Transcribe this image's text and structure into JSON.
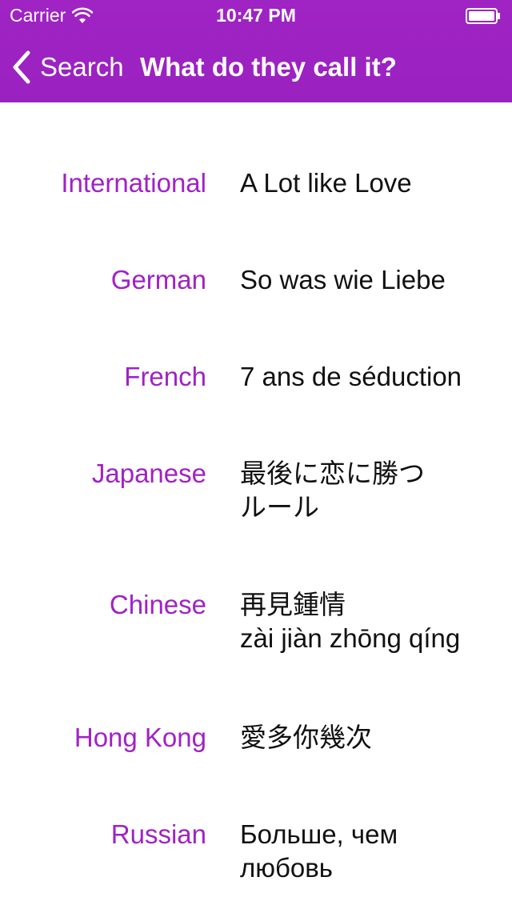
{
  "status_bar": {
    "carrier": "Carrier",
    "time": "10:47 PM"
  },
  "nav": {
    "back_label": "Search",
    "title": "What do they call it?"
  },
  "colors": {
    "header_bg": "#9e22c2",
    "label_color": "#a022c6",
    "value_color": "#111111"
  },
  "titles": [
    {
      "language": "International",
      "lines": [
        "A Lot like Love"
      ]
    },
    {
      "language": "German",
      "lines": [
        "So was wie Liebe"
      ]
    },
    {
      "language": "French",
      "lines": [
        "7 ans de séduction"
      ]
    },
    {
      "language": "Japanese",
      "lines": [
        "最後に恋に勝つ",
        "ルール"
      ]
    },
    {
      "language": "Chinese",
      "lines": [
        "再見鍾情",
        "zài jiàn zhōng qíng"
      ]
    },
    {
      "language": "Hong Kong",
      "lines": [
        "愛多你幾次"
      ]
    },
    {
      "language": "Russian",
      "lines": [
        "Больше, чем",
        "любовь"
      ]
    }
  ]
}
